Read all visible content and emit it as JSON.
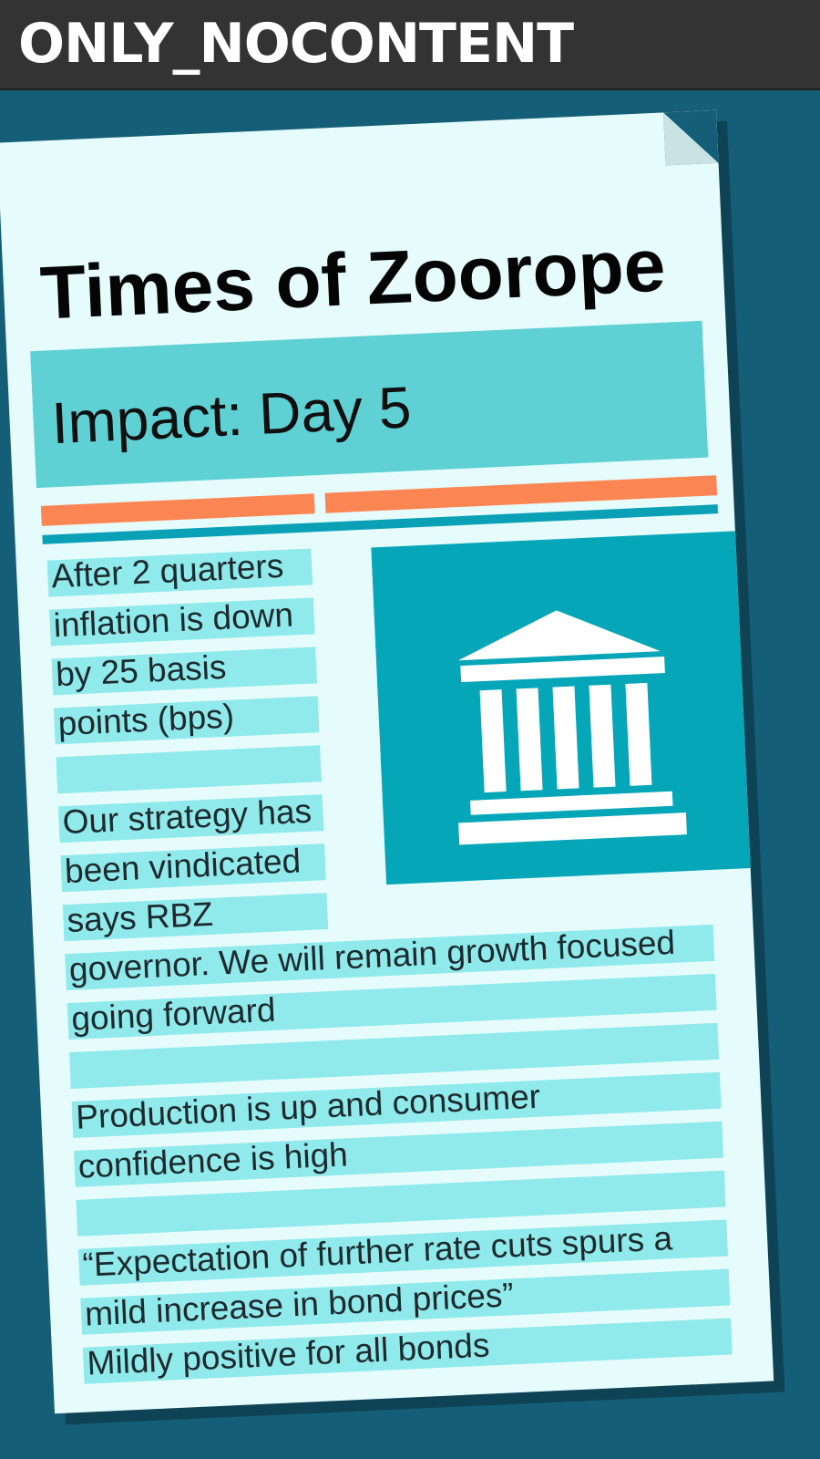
{
  "banner": {
    "label": "ONLY_NOCONTENT"
  },
  "newspaper": {
    "masthead": "Times of Zoorope",
    "headline": "Impact: Day 5",
    "illustration": "bank-building-icon",
    "lines": [
      "After 2 quarters",
      "inflation is down",
      "by 25 basis",
      "points (bps)",
      "",
      "Our strategy has",
      "been vindicated",
      "says RBZ",
      "governor. We will remain growth focused",
      "going forward",
      "",
      "Production is up and consumer",
      "confidence is high",
      "",
      "“Expectation of further rate cuts spurs a",
      "mild increase in bond prices”",
      "Mildly positive for all bonds"
    ]
  },
  "colors": {
    "background": "#155e78",
    "banner": "#333333",
    "paper": "#e6fcfc",
    "headline_bar": "#5fd0d4",
    "accent_orange": "#fb8653",
    "accent_teal": "#0aa1b6",
    "line_highlight": "#90e9ea",
    "illustration_bg": "#05a6b7"
  }
}
